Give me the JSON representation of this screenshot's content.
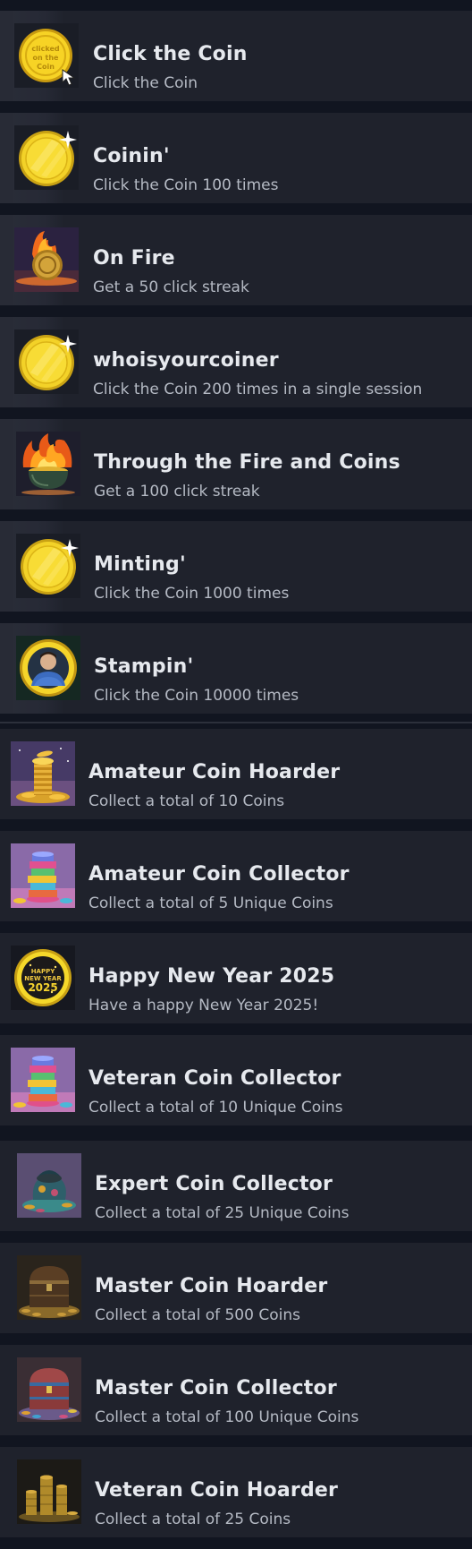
{
  "achievements": [
    {
      "title": "Click the Coin",
      "description": "Click the Coin",
      "icon": "gold-coin-click-icon",
      "coin_text": "clicked on the Coin"
    },
    {
      "title": "Coinin'",
      "description": "Click the Coin 100 times",
      "icon": "shiny-gold-coin-icon"
    },
    {
      "title": "On Fire",
      "description": "Get a 50 click streak",
      "icon": "flaming-coin-icon"
    },
    {
      "title": "whoisyourcoiner",
      "description": "Click the Coin 200 times in a single session",
      "icon": "shiny-gold-coin-icon"
    },
    {
      "title": "Through the Fire and Coins",
      "description": "Get a 100 click streak",
      "icon": "fire-cauldron-icon"
    },
    {
      "title": "Minting'",
      "description": "Click the Coin 1000 times",
      "icon": "shiny-gold-coin-icon"
    },
    {
      "title": "Stampin'",
      "description": "Click the Coin 10000 times",
      "icon": "portrait-coin-icon"
    },
    {
      "title": "Amateur Coin Hoarder",
      "description": "Collect a total of 10 Coins",
      "icon": "coin-stack-icon"
    },
    {
      "title": "Amateur Coin Collector",
      "description": "Collect a total of 5 Unique Coins",
      "icon": "colorful-coin-stack-icon"
    },
    {
      "title": "Happy New Year 2025",
      "description": "Have a happy New Year 2025!",
      "icon": "new-year-coin-icon",
      "coin_text_top": "HAPPY NEW YEAR",
      "coin_text_year": "2025"
    },
    {
      "title": "Veteran Coin Collector",
      "description": "Collect a total of 10 Unique Coins",
      "icon": "colorful-coin-stack-icon"
    },
    {
      "title": "Expert Coin Collector",
      "description": "Collect a total of 25 Unique Coins",
      "icon": "coin-pouch-icon"
    },
    {
      "title": "Master Coin Hoarder",
      "description": "Collect a total of 500 Coins",
      "icon": "treasure-chest-icon"
    },
    {
      "title": "Master Coin Collector",
      "description": "Collect a total of 100 Unique Coins",
      "icon": "colorful-treasure-chest-icon"
    },
    {
      "title": "Veteran Coin Hoarder",
      "description": "Collect a total of 25 Coins",
      "icon": "coin-towers-icon"
    }
  ],
  "colors": {
    "page_background": "#111520",
    "row_background": "#1f222c",
    "title_text": "#e6e9ee",
    "description_text": "#b5bac4",
    "coin_gold": "#f5d21e"
  }
}
